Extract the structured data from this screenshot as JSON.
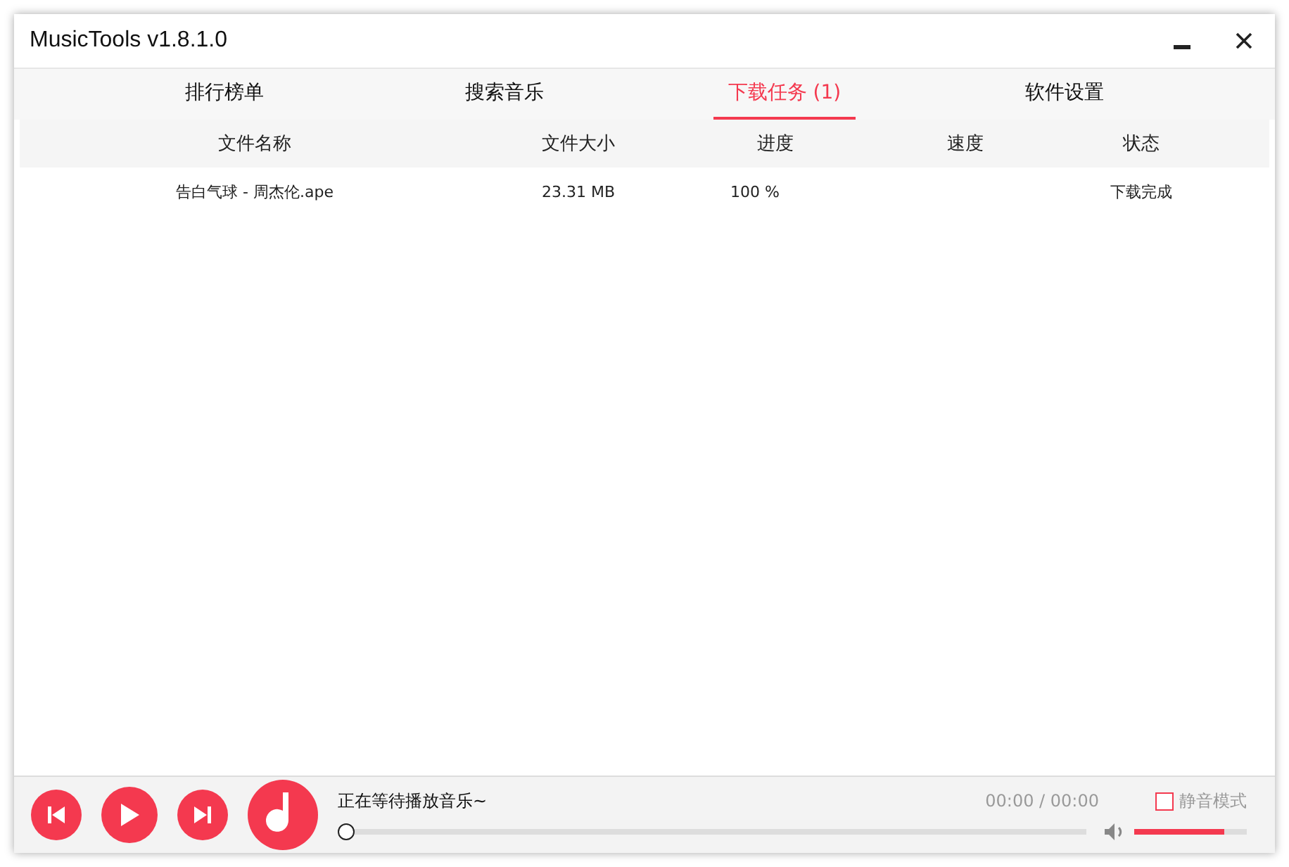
{
  "window": {
    "title": "MusicTools v1.8.1.0"
  },
  "tabs": [
    {
      "label": "排行榜单",
      "selected": false
    },
    {
      "label": "搜索音乐",
      "selected": false
    },
    {
      "label": "下载任务 (1)",
      "selected": true
    },
    {
      "label": "软件设置",
      "selected": false
    }
  ],
  "table": {
    "columns": [
      "文件名称",
      "文件大小",
      "进度",
      "速度",
      "状态"
    ],
    "rows": [
      [
        "告白气球 - 周杰伦.ape",
        "23.31 MB",
        "100 %",
        "",
        "下载完成"
      ]
    ]
  },
  "player": {
    "status": "正在等待播放音乐~",
    "progress": {
      "level": 0
    },
    "time": "00:00 / 00:00",
    "mute": {
      "label": "静音模式",
      "checked": false
    },
    "volume": {
      "level": 0.8
    }
  }
}
